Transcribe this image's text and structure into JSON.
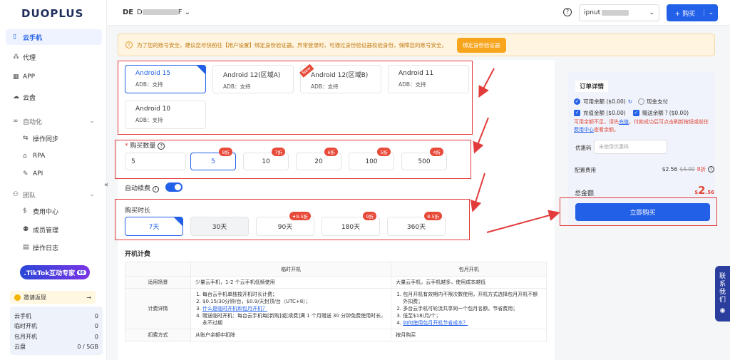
{
  "brand": {
    "logo": "DUOPLUS"
  },
  "sidebar": {
    "items": [
      {
        "label": "云手机",
        "icon": "phone-icon"
      },
      {
        "label": "代理",
        "icon": "proxy-icon"
      },
      {
        "label": "APP",
        "icon": "app-grid-icon"
      },
      {
        "label": "云盘",
        "icon": "cloud-icon"
      },
      {
        "label": "自动化",
        "icon": "infinity-icon"
      },
      {
        "label": "操作同步",
        "icon": "sync-icon"
      },
      {
        "label": "RPA",
        "icon": "robot-icon"
      },
      {
        "label": "API",
        "icon": "api-icon"
      },
      {
        "label": "团队",
        "icon": "team-icon"
      },
      {
        "label": "费用中心",
        "icon": "dollar-icon"
      },
      {
        "label": "成员管理",
        "icon": "members-icon"
      },
      {
        "label": "操作日志",
        "icon": "log-icon"
      }
    ],
    "promo": {
      "text": ".TikTok互动专家",
      "badge": "60"
    },
    "invite": {
      "label": "邀请返现",
      "arrow": "→"
    },
    "counts": [
      {
        "label": "云手机",
        "value": "0"
      },
      {
        "label": "临时开机",
        "value": "0"
      },
      {
        "label": "包月开机",
        "value": "0"
      },
      {
        "label": "云盘",
        "value": "0 / 5GB"
      }
    ],
    "collapse": "«"
  },
  "topbar": {
    "workspace_code": "DE",
    "workspace_name_prefix": "D",
    "workspace_name_suffix": "F",
    "help": "?",
    "user_prefix": "ipnut",
    "buy_label": "+ 购买"
  },
  "notice": {
    "text": "为了您的账号安全，建议您尽快前往【用户设置】绑定身份验证器。异常登录时，可通过身份验证器校验身份，保障您的账号安全。",
    "button": "绑定身份验证器"
  },
  "versions": [
    {
      "name": "Android 15",
      "adb": "ADB：支持",
      "selected": true,
      "new": false
    },
    {
      "name": "Android 12(区域A)",
      "adb": "ADB：支持",
      "selected": false,
      "new": false
    },
    {
      "name": "Android 12(区域B)",
      "adb": "ADB：支持",
      "selected": false,
      "new": true
    },
    {
      "name": "Android 11",
      "adb": "ADB：支持",
      "selected": false,
      "new": false
    },
    {
      "name": "Android 10",
      "adb": "ADB：支持",
      "selected": false,
      "new": false
    }
  ],
  "new_tag": "New",
  "quantity": {
    "label": "购买数量",
    "required": "*",
    "help": "?",
    "input_value": "5",
    "options": [
      {
        "value": "5",
        "discount": "8折",
        "selected": true
      },
      {
        "value": "10",
        "discount": "7折",
        "selected": false
      },
      {
        "value": "20",
        "discount": "6折",
        "selected": false
      },
      {
        "value": "100",
        "discount": "5折",
        "selected": false
      },
      {
        "value": "500",
        "discount": "4折",
        "selected": false
      }
    ]
  },
  "auto_renew": {
    "label": "自动续费",
    "info": "i",
    "on": true
  },
  "duration": {
    "label": "购买时长",
    "options": [
      {
        "value": "7天",
        "discount": "",
        "selected": true
      },
      {
        "value": "30天",
        "discount": "",
        "selected": false
      },
      {
        "value": "90天",
        "discount": "9.5折",
        "selected": false
      },
      {
        "value": "180天",
        "discount": "9折",
        "selected": false
      },
      {
        "value": "360天",
        "discount": "8.5折",
        "selected": false
      }
    ]
  },
  "billing": {
    "title": "开机计费",
    "headers": [
      "",
      "临时开机",
      "包月开机"
    ],
    "scene_label": "适用场景",
    "scene_temp": "少量云手机，1-2 个云手机低频使用",
    "scene_month": "大量云手机，云手机越多，使用成本越低",
    "detail_label": "计费详情",
    "temp_items": [
      "每台云手机单独按开机时长计费；",
      "$0.15/30分钟/台，$0.9/天封顶/台（UTC+8）；",
      "什么是临时开机和包月开机？",
      "赠送临时开机：每台云手机每[新购]或[续费]满 1 个月赠送 30 分钟免费使用时长，永不过期"
    ],
    "month_items": [
      "包月开机有效期内不限次数使用，开机方式选择包月开机不额外扣费；",
      "多台云手机可轮流共享同一个包月名额，节省费用；",
      "低至$18/月/个；",
      "如何使用包月开机节省成本？"
    ],
    "row3_label": "扣费方式",
    "row3_temp": "从账户余额中扣除",
    "row3_month": "按月购买"
  },
  "order": {
    "title": "订单详情",
    "balance": "可用余额 ($0.00)",
    "refresh": "↻",
    "cash": "现金支付",
    "topup": "充值金额 ($0.00)",
    "gift": "赠送余额",
    "gift_help": "?",
    "gift_amount": "($0.00)",
    "warn_a": "可用余额不足，请先",
    "warn_link1": "充值",
    "warn_b": "，付款成功后可点击刷新按钮或前往",
    "warn_link2": "费用中心",
    "warn_c": "查看余额。",
    "coupon_label": "优惠码",
    "coupon_placeholder": "未使用优惠码",
    "fee_label": "配置费用",
    "fee_price": "$2.56",
    "fee_original": "$4.00",
    "fee_discount": "8折",
    "fee_info": "i",
    "total_label": "总金额",
    "total_currency": "$",
    "total_int": "2",
    "total_dec": ".56",
    "buy_now": "立即购买"
  },
  "contact": {
    "text": "联系我们"
  }
}
